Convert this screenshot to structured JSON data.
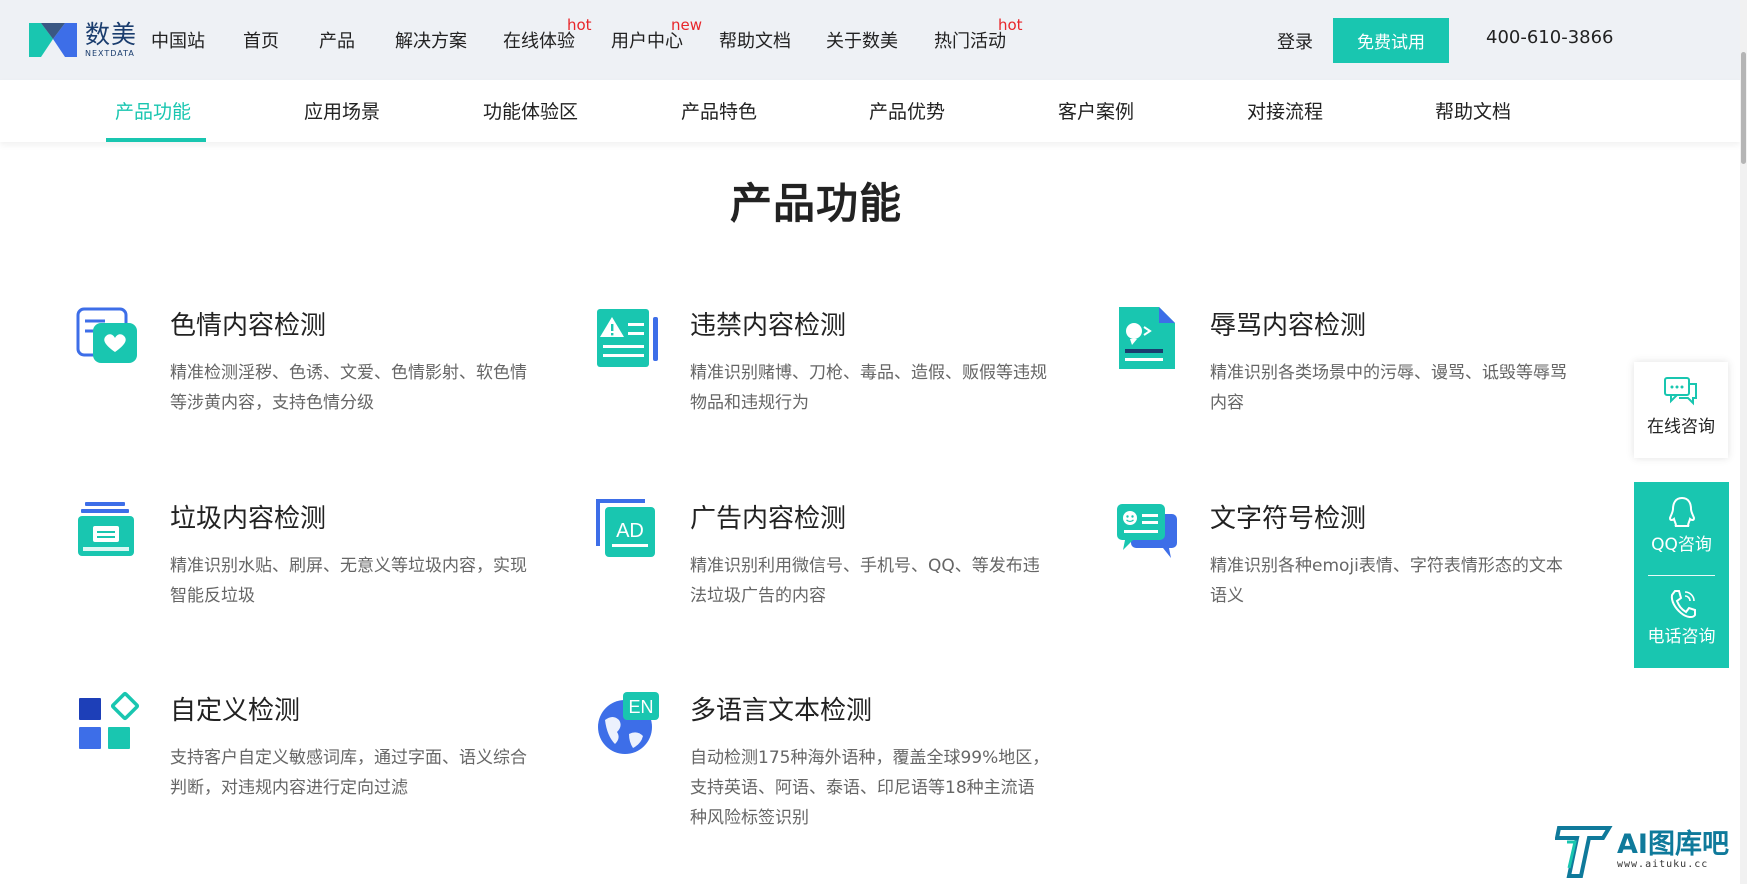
{
  "header": {
    "logo_cn": "数美",
    "logo_en": "NEXTDATA",
    "nav": [
      {
        "label": "中国站",
        "badge": ""
      },
      {
        "label": "首页",
        "badge": ""
      },
      {
        "label": "产品",
        "badge": ""
      },
      {
        "label": "解决方案",
        "badge": ""
      },
      {
        "label": "在线体验",
        "badge": "hot"
      },
      {
        "label": "用户中心",
        "badge": "new"
      },
      {
        "label": "帮助文档",
        "badge": ""
      },
      {
        "label": "关于数美",
        "badge": ""
      },
      {
        "label": "热门活动",
        "badge": "hot"
      }
    ],
    "login_label": "登录",
    "trial_label": "免费试用",
    "phone": "400-610-3866"
  },
  "subnav": {
    "tabs": [
      "产品功能",
      "应用场景",
      "功能体验区",
      "产品特色",
      "产品优势",
      "客户案例",
      "对接流程",
      "帮助文档"
    ],
    "active_index": 0
  },
  "main": {
    "title": "产品功能",
    "features": [
      {
        "title": "色情内容检测",
        "desc": "精准检测淫秽、色诱、文爱、色情影射、软色情等涉黄内容，支持色情分级",
        "icon": "heart-chat-icon"
      },
      {
        "title": "违禁内容检测",
        "desc": "精准识别赌博、刀枪、毒品、造假、贩假等违规物品和违规行为",
        "icon": "warning-document-icon"
      },
      {
        "title": "辱骂内容检测",
        "desc": "精准识别各类场景中的污辱、谩骂、诋毁等辱骂内容",
        "icon": "abuse-document-icon"
      },
      {
        "title": "垃圾内容检测",
        "desc": "精准识别水贴、刷屏、无意义等垃圾内容，实现智能反垃圾",
        "icon": "inbox-tray-icon"
      },
      {
        "title": "广告内容检测",
        "desc": "精准识别利用微信号、手机号、QQ、等发布违法垃圾广告的内容",
        "icon": "ad-icon"
      },
      {
        "title": "文字符号检测",
        "desc": "精准识别各种emoji表情、字符表情形态的文本语义",
        "icon": "emoji-chat-icon"
      },
      {
        "title": "自定义检测",
        "desc": "支持客户自定义敏感词库，通过字面、语义综合判断，对违规内容进行定向过滤",
        "icon": "custom-blocks-icon"
      },
      {
        "title": "多语言文本检测",
        "desc": "自动检测175种海外语种，覆盖全球99%地区，支持英语、阿语、泰语、印尼语等18种主流语种风险标签识别",
        "icon": "globe-en-icon"
      }
    ]
  },
  "float": {
    "online_label": "在线咨询",
    "qq_label": "QQ咨询",
    "phone_label": "电话咨询"
  },
  "watermark": {
    "text": "AI图库吧",
    "url": "www.aituku.cc"
  },
  "colors": {
    "brand": "#19c6b0",
    "brand_blue": "#3d6ee8",
    "badge": "#e8262b"
  }
}
